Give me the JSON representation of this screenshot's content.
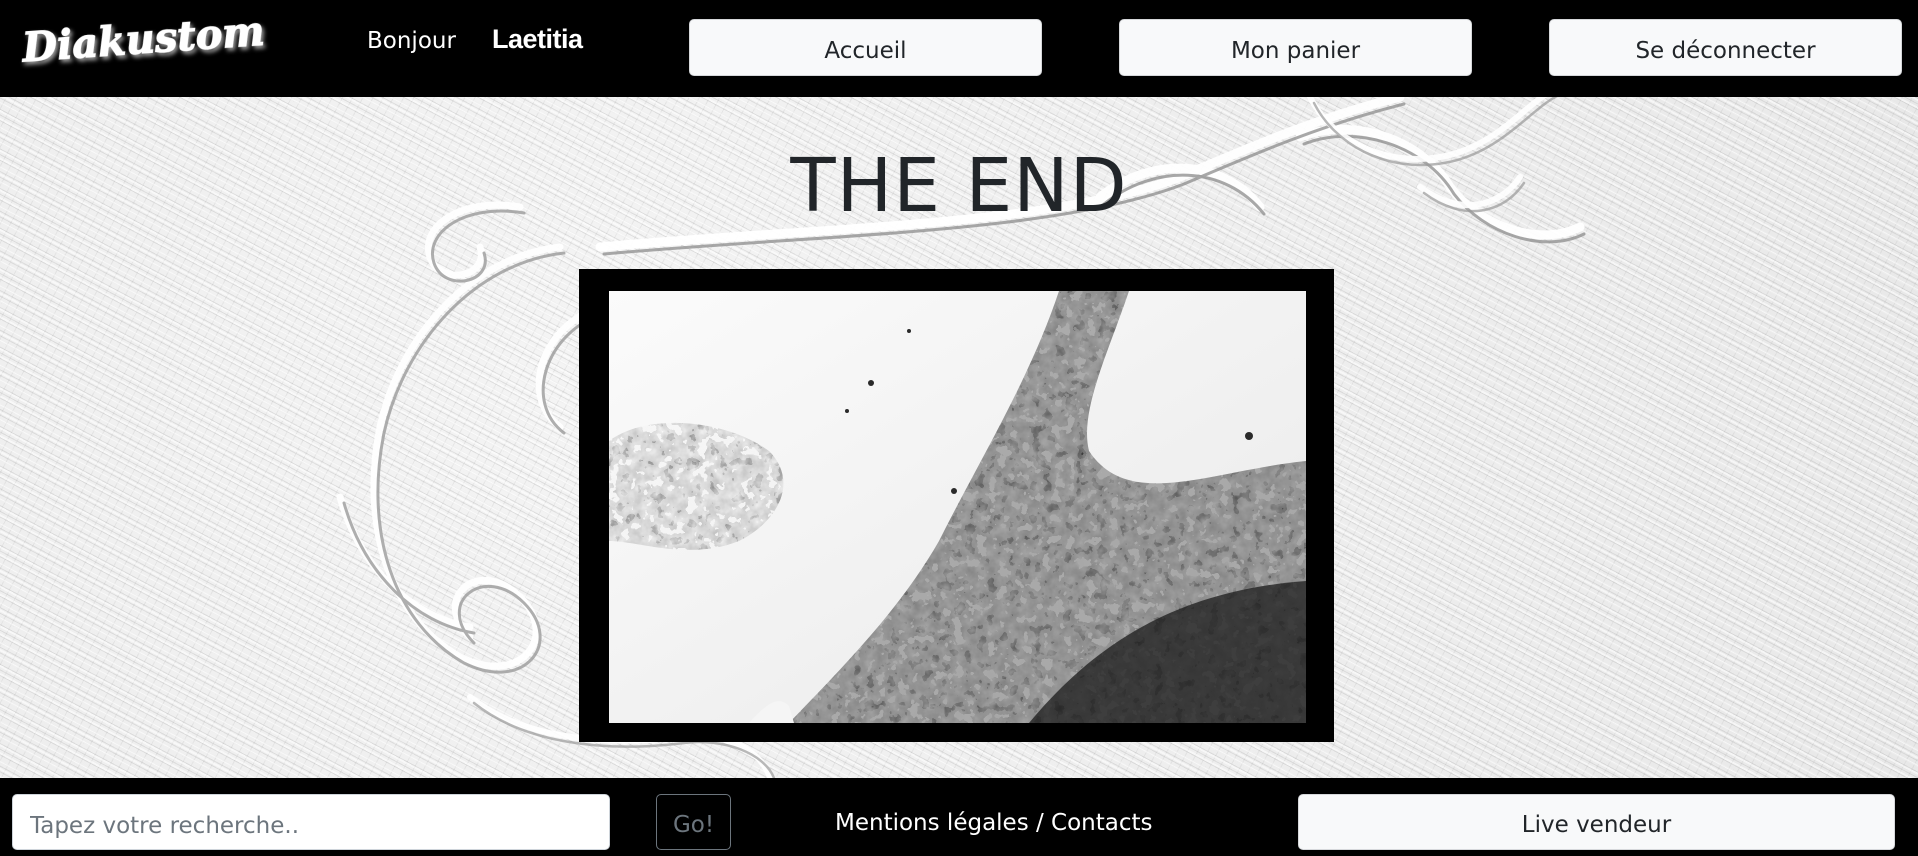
{
  "header": {
    "logo_text": "Diakustom",
    "greeting": "Bonjour",
    "username": "Laetitia",
    "nav": {
      "home": "Accueil",
      "cart": "Mon panier",
      "logout": "Se déconnecter"
    }
  },
  "main": {
    "title": "THE END"
  },
  "footer": {
    "search_placeholder": "Tapez votre recherche..",
    "search_value": "",
    "go_label": "Go!",
    "legal_link": "Mentions légales / Contacts",
    "live_seller": "Live vendeur"
  },
  "colors": {
    "bar_background": "#000000",
    "button_background": "#f8f9fa",
    "title_text": "#212529",
    "go_border": "#6c757d"
  },
  "icons": {
    "logo": "diakustom-script-logo"
  }
}
